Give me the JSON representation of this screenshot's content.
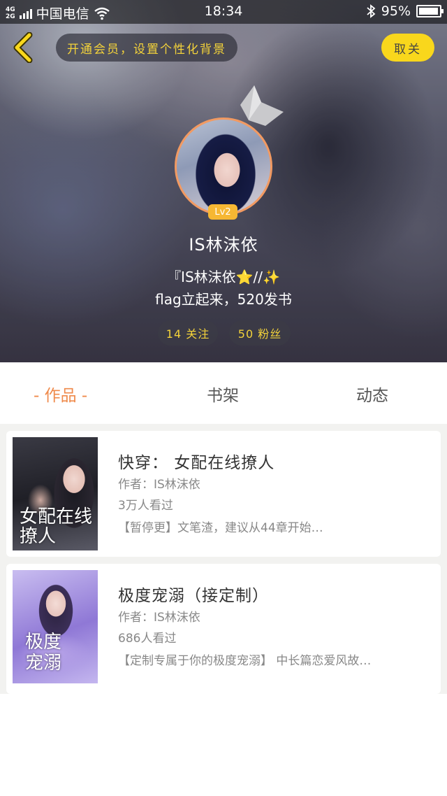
{
  "status_bar": {
    "network_top": "4G",
    "network_bottom": "2G",
    "carrier": "中国电信",
    "time": "18:34",
    "battery_percent": "95%",
    "battery_level": 0.95
  },
  "header": {
    "vip_prompt": "开通会员，设置个性化背景",
    "follow_label": "取关"
  },
  "profile": {
    "level": "Lv2",
    "username": "IS林沫依",
    "bio_line1": "『IS林沫依⭐//✨",
    "bio_line2": "flag立起来，520发书",
    "following": "14 关注",
    "fans": "50 粉丝"
  },
  "tabs": [
    {
      "label": "- 作品 -",
      "active": true
    },
    {
      "label": "书架",
      "active": false
    },
    {
      "label": "动态",
      "active": false
    }
  ],
  "books": [
    {
      "title": "快穿： 女配在线撩人",
      "author": "作者：IS林沫依",
      "reads": "3万人看过",
      "description": "【暂停更】文笔渣，建议从44章开始…",
      "cover_text": "女配在线撩人"
    },
    {
      "title": "极度宠溺（接定制）",
      "author": "作者：IS林沫依",
      "reads": "686人看过",
      "description": "【定制专属于你的极度宠溺】 中长篇恋爱风故…",
      "cover_text": "极度宠溺"
    }
  ],
  "colors": {
    "accent": "#ef8a4b",
    "vip_text": "#f3d23a",
    "follow_button": "#f9d71c",
    "level_badge": "#f6b733",
    "avatar_border": "#f29a62"
  }
}
